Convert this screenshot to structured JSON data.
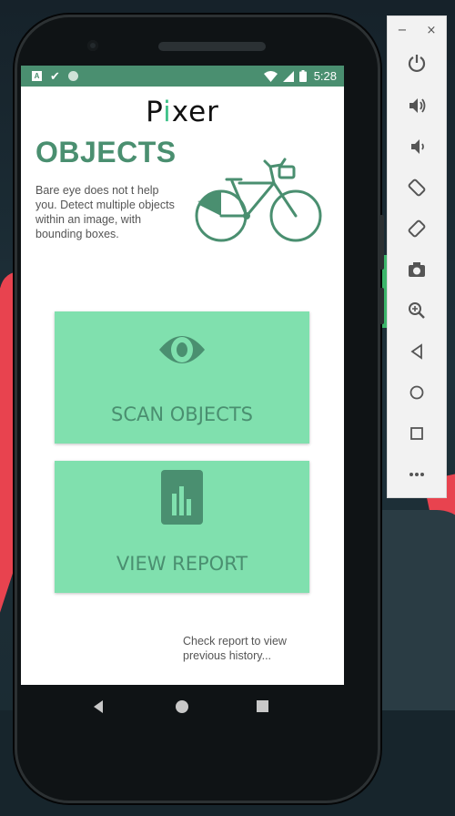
{
  "status_bar": {
    "time": "5:28",
    "notif_a": "A"
  },
  "app": {
    "brand_prefix": "P",
    "brand_accent": "i",
    "brand_suffix": "xer"
  },
  "hero": {
    "title": "OBJECTS",
    "description": "Bare eye does not t help you. Detect multiple objects within an image, with bounding boxes."
  },
  "cards": {
    "scan_label": "SCAN OBJECTS",
    "report_label": "VIEW REPORT"
  },
  "hint": "Check report to view previous history...",
  "toolbar": {
    "minimize": "−",
    "close": "×"
  },
  "colors": {
    "primary": "#4a8f70",
    "card": "#80e0ae",
    "accent": "#3fc28a"
  }
}
